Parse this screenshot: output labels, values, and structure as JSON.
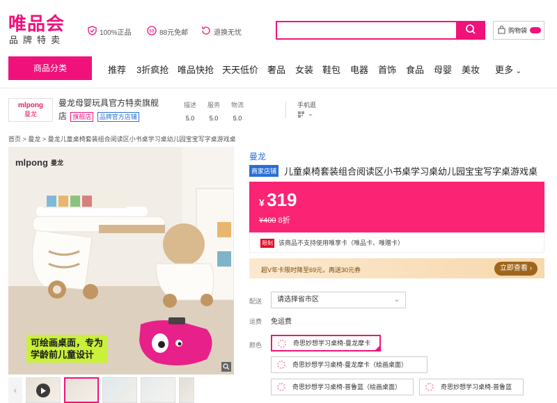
{
  "header": {
    "logo_main": "唯品会",
    "logo_sub": "品牌特卖",
    "promises": [
      "100%正品",
      "88元免邮",
      "退换无忧"
    ],
    "search": {
      "value": "",
      "placeholder": ""
    },
    "cart_label": "购物袋",
    "cart_count": ""
  },
  "nav": {
    "category_button": "商品分类",
    "items": [
      "推荐",
      "3折疯抢",
      "唯品快抢",
      "天天低价",
      "奢品",
      "女装",
      "鞋包",
      "电器",
      "首饰",
      "食品",
      "母婴",
      "美妆",
      "更多"
    ]
  },
  "shop": {
    "logo_en": "mlpong",
    "logo_cn": "曼龙",
    "name_line1": "曼龙母婴玩具官方特卖旗舰",
    "name_line2": "店",
    "tag_flagship": "旗舰店",
    "tag_official": "品牌官方店铺",
    "scores": [
      {
        "label": "描述",
        "value": "5.0"
      },
      {
        "label": "服务",
        "value": "5.0"
      },
      {
        "label": "物流",
        "value": "5.0"
      }
    ],
    "mobile_label": "手机逛"
  },
  "breadcrumb": [
    "首页",
    "曼龙",
    "曼龙儿童桌椅套装组合阅读区小书桌学习桌幼儿园宝宝写字桌游戏桌"
  ],
  "gallery": {
    "image_brand_en": "mlpong",
    "image_brand_cn": "曼龙",
    "image_caption_1": "可绘画桌面，专为",
    "image_caption_2": "学龄前儿童设计"
  },
  "product": {
    "brand": "曼龙",
    "title_tag": "商家店铺",
    "title": "儿童桌椅套装组合阅读区小书桌学习桌幼儿园宝宝写字桌游戏桌",
    "currency": "¥",
    "price": "319",
    "original_price": "¥400",
    "discount": "8折",
    "notice_tag": "限制",
    "notice": "该商品不支持使用唯享卡（唯品卡、唯赠卡）",
    "svip_text": "超V年卡限时降至69元，再送30元券",
    "svip_button": "立即查看 ›",
    "delivery_label": "配送",
    "region_placeholder": "请选择省市区",
    "freight_label": "运费",
    "freight_value": "免运费",
    "color_label": "颜色",
    "colors": [
      "奇思妙想学习桌椅-曼龙摩卡",
      "奇思妙想学习桌椅-曼龙摩卡（绘画桌面）",
      "奇思妙想学习桌椅-普鲁蓝（绘画桌面）",
      "奇思妙想学习桌椅-普鲁蓝"
    ]
  },
  "colors": {
    "brand": "#f0127a",
    "price_bg": "#fb2474",
    "link": "#2a6fd6"
  }
}
